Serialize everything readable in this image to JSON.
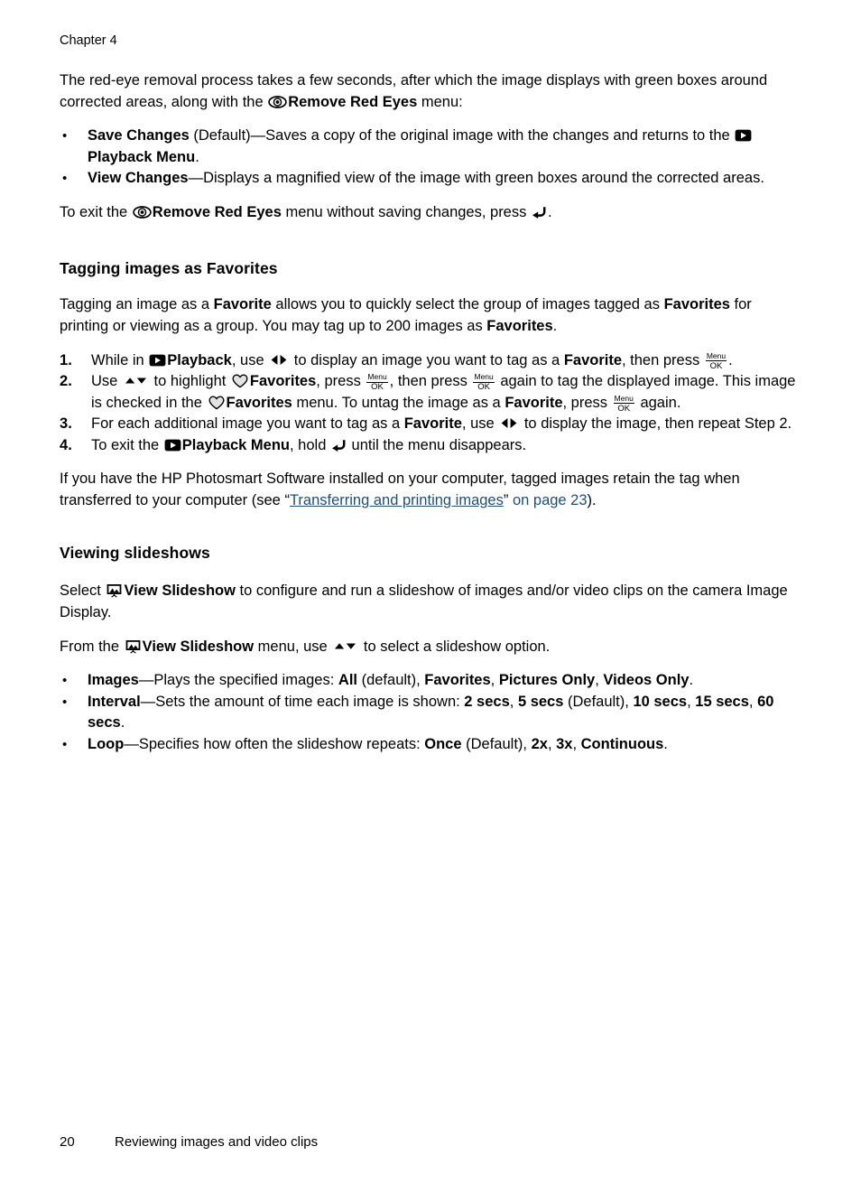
{
  "page": {
    "running_head": "Chapter 4",
    "footer_page_number": "20",
    "footer_title": "Reviewing images and video clips",
    "link_color": "#1F4E79"
  },
  "intro": {
    "para1_a": "The red-eye removal process takes a few seconds, after which the image displays with green boxes around corrected areas, along with the ",
    "para1_b": "Remove Red Eyes",
    "para1_c": " menu:",
    "bullets": [
      {
        "term": "Save Changes",
        "rest_a": " (Default)—Saves a copy of the original image with the changes and returns to the ",
        "term2": "Playback Menu",
        "rest_b": "."
      },
      {
        "term": "View Changes",
        "rest_a": "—Displays a magnified view of the image with green boxes around the corrected areas."
      }
    ],
    "exit_a": "To exit the ",
    "exit_b": "Remove Red Eyes",
    "exit_c": " menu without saving changes, press ",
    "exit_d": "."
  },
  "favorites": {
    "heading": "Tagging images as Favorites",
    "intro_a": "Tagging an image as a ",
    "intro_b": "Favorite",
    "intro_c": " allows you to quickly select the group of images tagged as ",
    "intro_d": "Favorites",
    "intro_e": " for printing or viewing as a group. You may tag up to 200 images as ",
    "intro_f": "Favorites",
    "intro_g": ".",
    "step1": {
      "a": "While in ",
      "b": "Playback",
      "c": ", use ",
      "d": " to display an image you want to tag as a ",
      "e": "Favorite",
      "f": ", then press ",
      "g": "."
    },
    "step2": {
      "a": "Use ",
      "b": " to highlight ",
      "c": "Favorites",
      "d": ", press ",
      "e": ", then press ",
      "f": " again to tag the displayed image. This image is checked in the ",
      "g": "Favorites",
      "h": " menu. To untag the image as a ",
      "i": "Favorite",
      "j": ", press ",
      "k": " again."
    },
    "step3": {
      "a": "For each additional image you want to tag as a ",
      "b": "Favorite",
      "c": ", use ",
      "d": " to display the image, then repeat Step 2."
    },
    "step4": {
      "a": "To exit the ",
      "b": "Playback Menu",
      "c": ", hold ",
      "d": " until the menu disappears."
    },
    "note_a": "If you have the HP Photosmart Software installed on your computer, tagged images retain the tag when transferred to your computer (see “",
    "note_link": "Transferring and printing images",
    "note_b": "” ",
    "note_link2": "on page 23",
    "note_c": ")."
  },
  "slideshows": {
    "heading": "Viewing slideshows",
    "para1_a": "Select ",
    "para1_b": "View Slideshow",
    "para1_c": " to configure and run a slideshow of images and/or video clips on the camera Image Display.",
    "para2_a": "From the ",
    "para2_b": "View Slideshow",
    "para2_c": " menu, use ",
    "para2_d": " to select a slideshow option.",
    "options": [
      {
        "term": "Images",
        "a": "—Plays the specified images: ",
        "v1": "All",
        "b": " (default), ",
        "v2": "Favorites",
        "c": ", ",
        "v3": "Pictures Only",
        "d": ", ",
        "v4": "Videos Only",
        "e": "."
      },
      {
        "term": "Interval",
        "a": "—Sets the amount of time each image is shown: ",
        "v1": "2 secs",
        "b": ", ",
        "v2": "5 secs",
        "c": " (Default), ",
        "v3": "10 secs",
        "d": ", ",
        "v4": "15 secs",
        "e": ", ",
        "v5": "60 secs",
        "f": "."
      },
      {
        "term": "Loop",
        "a": "—Specifies how often the slideshow repeats: ",
        "v1": "Once",
        "b": " (Default), ",
        "v2": "2x",
        "c": ", ",
        "v3": "3x",
        "d": ", ",
        "v4": "Continuous",
        "e": "."
      }
    ]
  },
  "icons": {
    "eye": "remove-red-eyes-icon",
    "playback": "playback-icon",
    "back": "back-arrow-icon",
    "left_right": "left-right-arrows-icon",
    "up_down": "up-down-arrows-icon",
    "heart": "favorites-heart-icon",
    "slideshow": "view-slideshow-icon",
    "menu_ok_top": "Menu",
    "menu_ok_bottom": "OK"
  }
}
